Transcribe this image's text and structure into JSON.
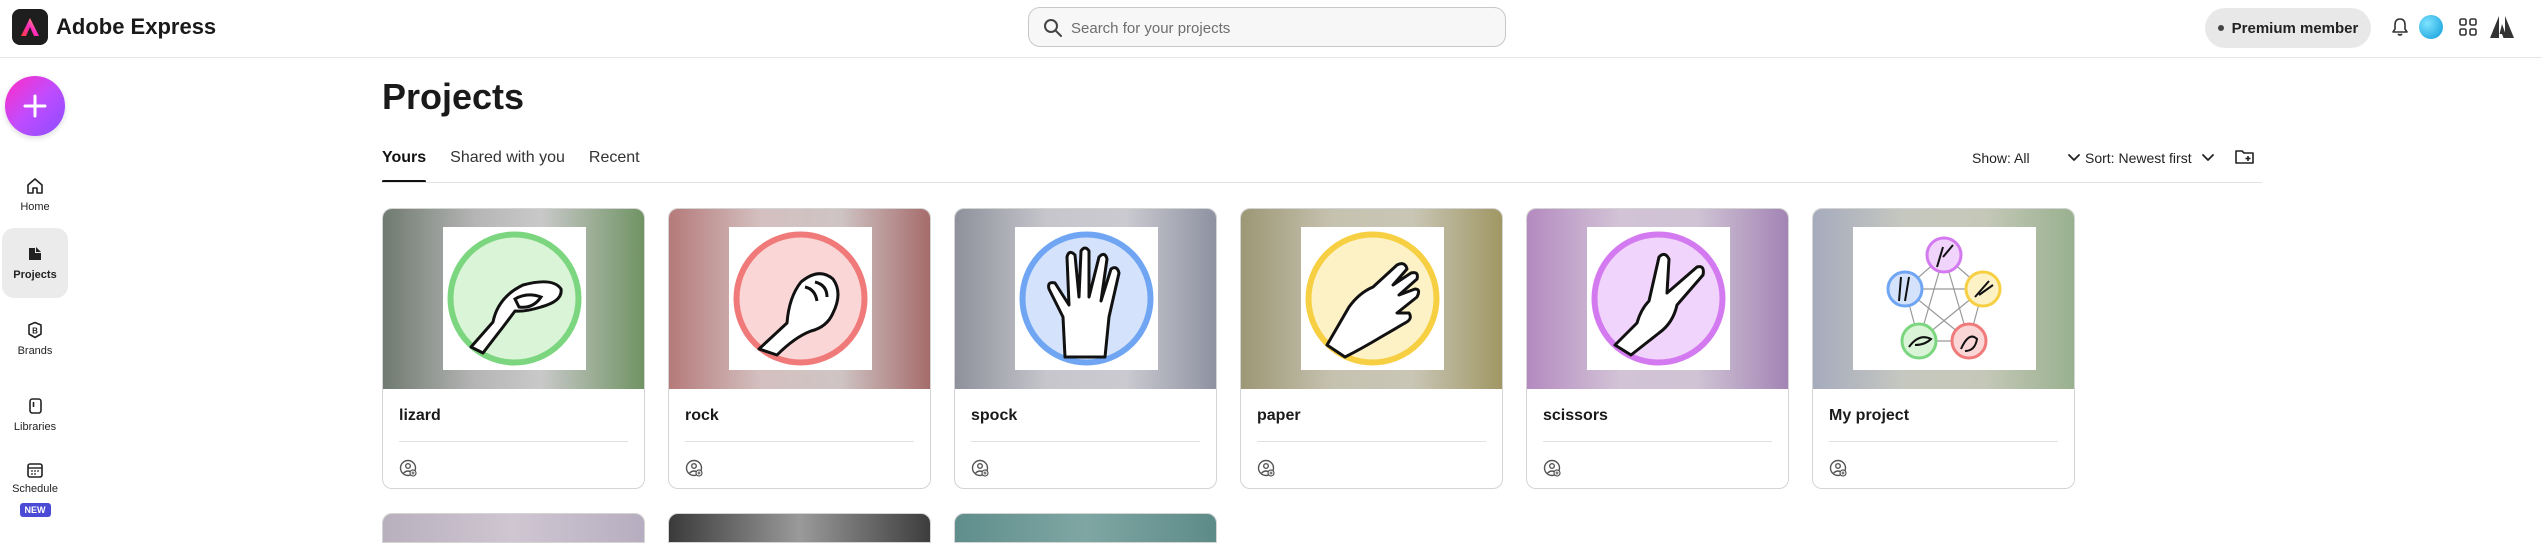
{
  "app": {
    "title": "Adobe Express"
  },
  "search": {
    "placeholder": "Search for your projects",
    "value": ""
  },
  "header": {
    "premium_label": "Premium member"
  },
  "sidebar": {
    "items": [
      {
        "label": "Home",
        "icon": "home-icon"
      },
      {
        "label": "Projects",
        "icon": "projects-icon",
        "active": true
      },
      {
        "label": "Brands",
        "icon": "brands-icon"
      },
      {
        "label": "Libraries",
        "icon": "libraries-icon"
      },
      {
        "label": "Schedule",
        "icon": "calendar-icon",
        "badge": "NEW"
      }
    ]
  },
  "page": {
    "title": "Projects"
  },
  "tabs": [
    {
      "label": "Yours",
      "active": true
    },
    {
      "label": "Shared with you"
    },
    {
      "label": "Recent"
    }
  ],
  "controls": {
    "show_label": "Show: All",
    "sort_label": "Sort: Newest first"
  },
  "projects": [
    {
      "title": "lizard",
      "ring": "#7bd67f",
      "fill": "#d9f4d6",
      "bg": [
        "#7d8a7c",
        "#b9b9b9",
        "#7e9f6e"
      ]
    },
    {
      "title": "rock",
      "ring": "#f07a7a",
      "fill": "#fbd6d6",
      "bg": [
        "#c48a8a",
        "#d8c6c6",
        "#b27676"
      ]
    },
    {
      "title": "spock",
      "ring": "#6fa5f2",
      "fill": "#d4e3fb",
      "bg": [
        "#9c9fa8",
        "#c8c8cf",
        "#8f94a4"
      ]
    },
    {
      "title": "paper",
      "ring": "#f6cf43",
      "fill": "#fdf1c6",
      "bg": [
        "#a6a07a",
        "#c9c5b3",
        "#a59d6c"
      ]
    },
    {
      "title": "scissors",
      "ring": "#d47af0",
      "fill": "#f1d4fb",
      "bg": [
        "#b98fc4",
        "#d3c4d8",
        "#a588b6"
      ]
    },
    {
      "title": "My project",
      "ring": "#cccccc",
      "fill": "#ffffff",
      "bg": [
        "#a9afc0",
        "#c4c7b8",
        "#9eb595"
      ]
    }
  ]
}
